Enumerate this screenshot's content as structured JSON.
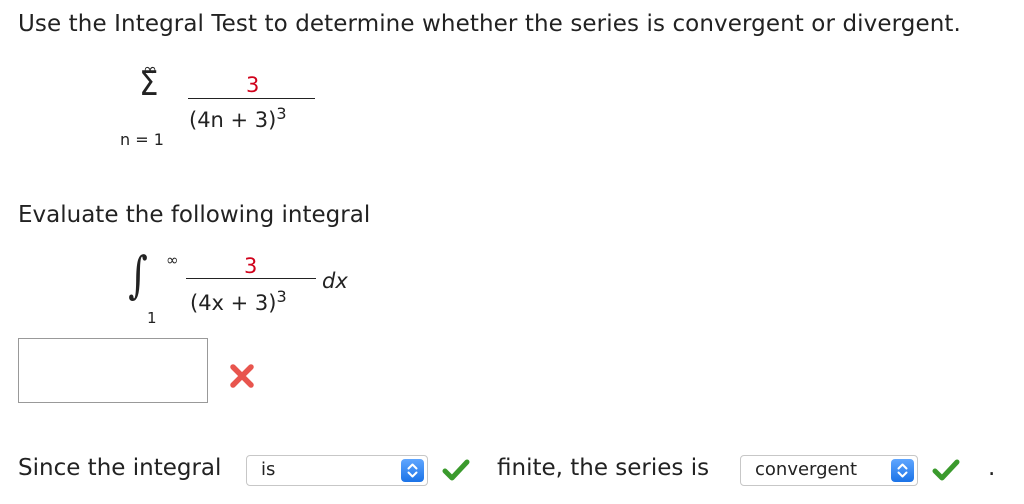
{
  "question": {
    "title": "Use the Integral Test to determine whether the series is convergent or divergent."
  },
  "series": {
    "upper": "∞",
    "sigma": "Σ",
    "lower": "n = 1",
    "numerator": "3",
    "denominator_base": "(4n + 3)",
    "denominator_exp": "3"
  },
  "integral_section": {
    "prompt": "Evaluate the following integral",
    "upper": "∞",
    "lower": "1",
    "numerator": "3",
    "denominator_base": "(4x + 3)",
    "denominator_exp": "3",
    "differential": "dx"
  },
  "answer": {
    "value": "",
    "status_icon": "incorrect-x-icon"
  },
  "conclusion": {
    "prefix": "Since the integral",
    "select1_value": "is",
    "middle": "finite, the series is",
    "select2_value": "convergent",
    "suffix": ".",
    "status_icon": "correct-check-icon"
  },
  "colors": {
    "highlight": "#d0021b",
    "check": "#3a9a2c",
    "cross": "#e8554e",
    "select_arrow": "#1a73e8"
  }
}
